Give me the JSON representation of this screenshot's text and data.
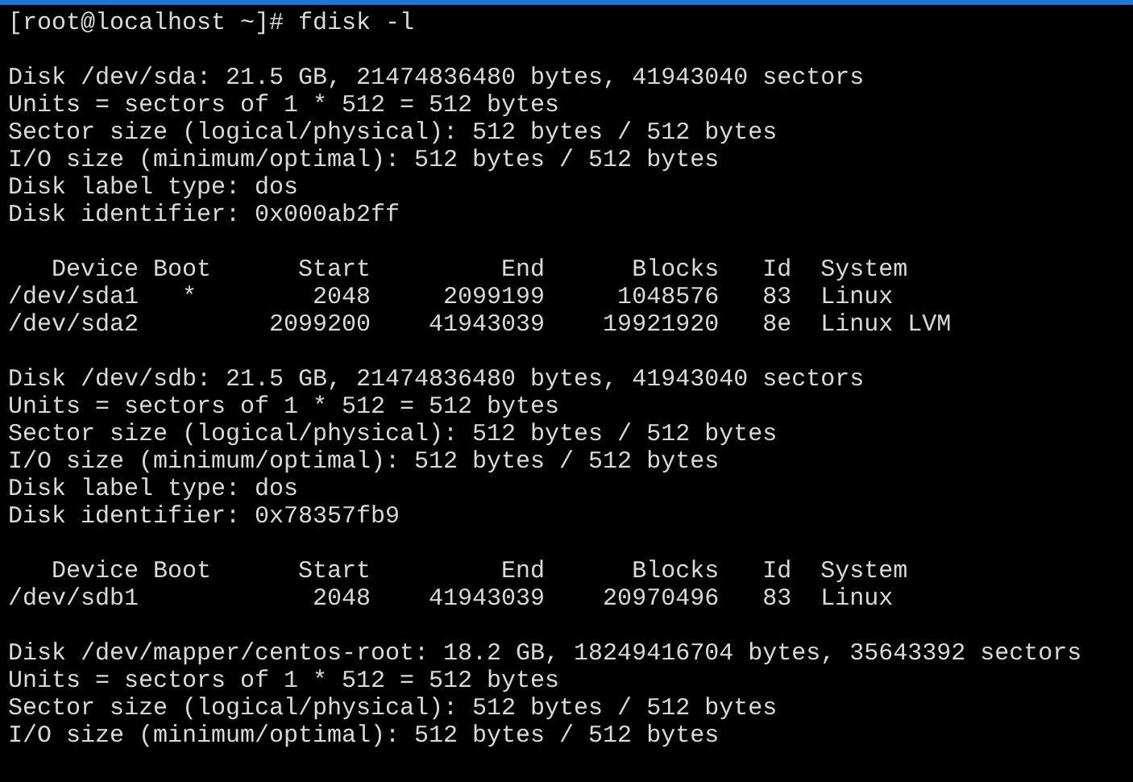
{
  "terminal": {
    "blocks": [
      [
        "[root@localhost ~]# fdisk -l"
      ],
      [
        "Disk /dev/sda: 21.5 GB, 21474836480 bytes, 41943040 sectors",
        "Units = sectors of 1 * 512 = 512 bytes",
        "Sector size (logical/physical): 512 bytes / 512 bytes",
        "I/O size (minimum/optimal): 512 bytes / 512 bytes",
        "Disk label type: dos",
        "Disk identifier: 0x000ab2ff"
      ],
      [
        "   Device Boot      Start         End      Blocks   Id  System",
        "/dev/sda1   *        2048     2099199     1048576   83  Linux",
        "/dev/sda2         2099200    41943039    19921920   8e  Linux LVM"
      ],
      [
        "Disk /dev/sdb: 21.5 GB, 21474836480 bytes, 41943040 sectors",
        "Units = sectors of 1 * 512 = 512 bytes",
        "Sector size (logical/physical): 512 bytes / 512 bytes",
        "I/O size (minimum/optimal): 512 bytes / 512 bytes",
        "Disk label type: dos",
        "Disk identifier: 0x78357fb9"
      ],
      [
        "   Device Boot      Start         End      Blocks   Id  System",
        "/dev/sdb1            2048    41943039    20970496   83  Linux"
      ],
      [
        "Disk /dev/mapper/centos-root: 18.2 GB, 18249416704 bytes, 35643392 sectors",
        "Units = sectors of 1 * 512 = 512 bytes",
        "Sector size (logical/physical): 512 bytes / 512 bytes",
        "I/O size (minimum/optimal): 512 bytes / 512 bytes"
      ]
    ]
  }
}
